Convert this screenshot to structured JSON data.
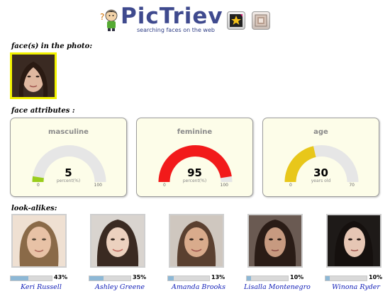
{
  "header": {
    "logo_text": "PicTriev",
    "tagline": "searching faces on the web",
    "buttons": [
      {
        "icon": "star-tool-icon"
      },
      {
        "icon": "photo-tool-icon"
      }
    ]
  },
  "sections": {
    "faces": "face(s) in the photo:",
    "attributes": "face attributes :",
    "lookalikes": "look-alikes:"
  },
  "attributes": [
    {
      "title": "masculine",
      "value": "5",
      "level": 0.05,
      "unit": "percent(%)",
      "min": "0",
      "max": "100",
      "color": "#9acd1c"
    },
    {
      "title": "feminine",
      "value": "95",
      "level": 0.95,
      "unit": "percent(%)",
      "min": "0",
      "max": "100",
      "color": "#f21a1a"
    },
    {
      "title": "age",
      "value": "30",
      "level": 0.4286,
      "unit": "years old",
      "min": "0",
      "max": "70",
      "color": "#e8c71a"
    }
  ],
  "lookalikes": [
    {
      "name": "Keri Russell",
      "pct": "43%",
      "level": 0.43
    },
    {
      "name": "Ashley Greene",
      "pct": "35%",
      "level": 0.35
    },
    {
      "name": "Amanda Brooks",
      "pct": "13%",
      "level": 0.13
    },
    {
      "name": "Lisalla Montenegro",
      "pct": "10%",
      "level": 0.1
    },
    {
      "name": "Winona Ryder",
      "pct": "10%",
      "level": 0.1
    }
  ]
}
